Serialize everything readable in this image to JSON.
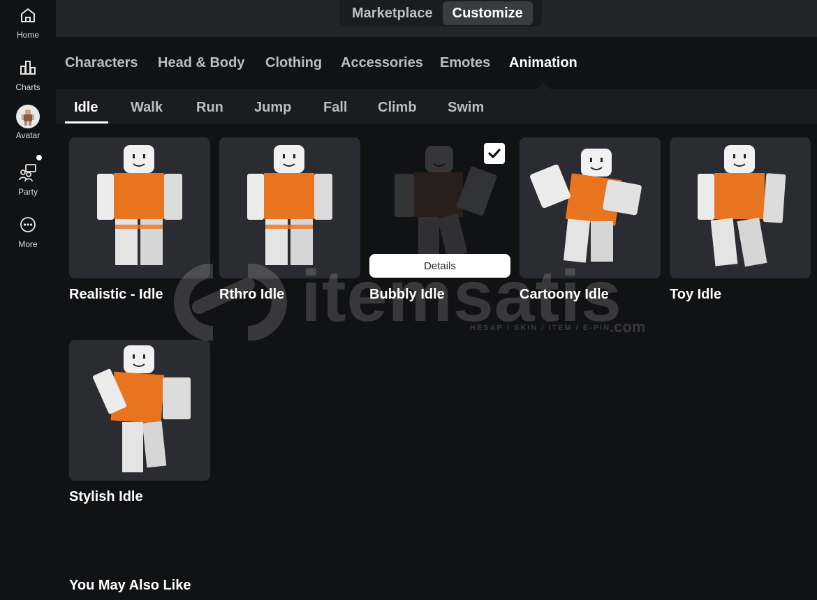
{
  "nav": {
    "items": [
      {
        "label": "Home",
        "icon": "home-icon"
      },
      {
        "label": "Charts",
        "icon": "charts-icon"
      },
      {
        "label": "Avatar",
        "icon": "avatar-icon"
      },
      {
        "label": "Party",
        "icon": "party-icon"
      },
      {
        "label": "More",
        "icon": "more-icon"
      }
    ]
  },
  "topbar": {
    "marketplace": "Marketplace",
    "customize": "Customize",
    "active": "Customize"
  },
  "categories": [
    "Characters",
    "Head & Body",
    "Clothing",
    "Accessories",
    "Emotes",
    "Animation"
  ],
  "active_category": "Animation",
  "subtabs": [
    "Idle",
    "Walk",
    "Run",
    "Jump",
    "Fall",
    "Climb",
    "Swim"
  ],
  "active_subtab": "Idle",
  "items": [
    {
      "name": "Realistic - Idle",
      "pose": "stand"
    },
    {
      "name": "Rthro Idle",
      "pose": "stand"
    },
    {
      "name": "Bubbly Idle",
      "pose": "selected",
      "selected": true,
      "details_label": "Details"
    },
    {
      "name": "Cartoony Idle",
      "pose": "wave"
    },
    {
      "name": "Toy Idle",
      "pose": "stand"
    },
    {
      "name": "Stylish Idle",
      "pose": "lean"
    }
  ],
  "section_title": "You May Also Like",
  "watermark": {
    "text": "itemsatis",
    "sub": "HESAP / SKIN / ITEM / E-PIN",
    "suffix": ".com"
  },
  "colors": {
    "background": "#111214",
    "topbar": "#232527",
    "card": "#2b2c31",
    "shirt": "#e8741f"
  }
}
